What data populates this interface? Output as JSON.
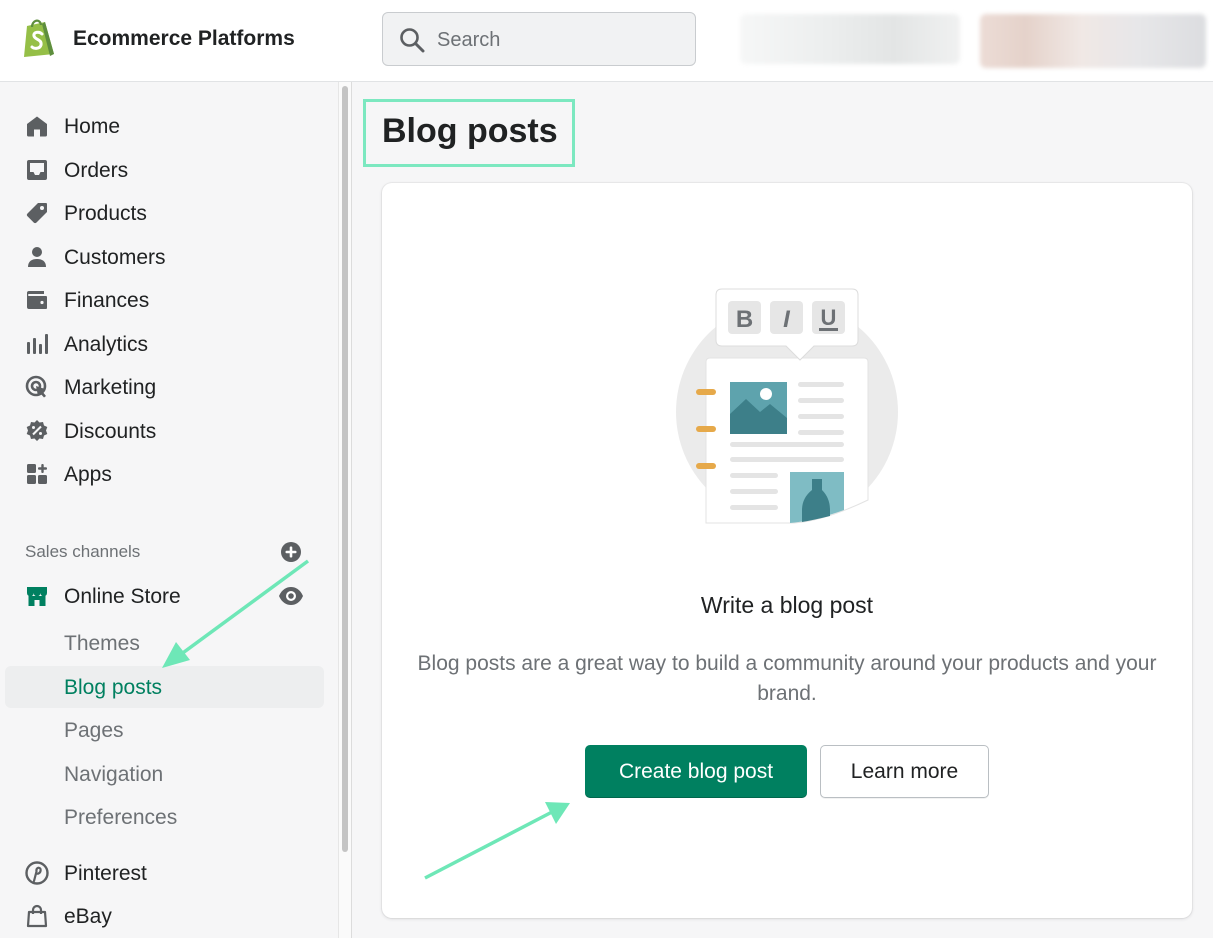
{
  "header": {
    "store_name": "Ecommerce Platforms",
    "search_placeholder": "Search"
  },
  "sidebar": {
    "items": [
      {
        "label": "Home",
        "icon": "home-icon"
      },
      {
        "label": "Orders",
        "icon": "inbox-icon"
      },
      {
        "label": "Products",
        "icon": "tag-icon"
      },
      {
        "label": "Customers",
        "icon": "person-icon"
      },
      {
        "label": "Finances",
        "icon": "wallet-icon"
      },
      {
        "label": "Analytics",
        "icon": "bar-chart-icon"
      },
      {
        "label": "Marketing",
        "icon": "target-icon"
      },
      {
        "label": "Discounts",
        "icon": "discount-icon"
      },
      {
        "label": "Apps",
        "icon": "apps-icon"
      }
    ],
    "sales_channels_label": "Sales channels",
    "online_store": {
      "label": "Online Store",
      "sub_items": [
        "Themes",
        "Blog posts",
        "Pages",
        "Navigation",
        "Preferences"
      ],
      "active": "Blog posts"
    },
    "channels": [
      {
        "label": "Pinterest",
        "icon": "pinterest-icon"
      },
      {
        "label": "eBay",
        "icon": "shopping-bag-icon"
      }
    ]
  },
  "main": {
    "page_title": "Blog posts",
    "empty_state": {
      "heading": "Write a blog post",
      "description": "Blog posts are a great way to build a community around your products and your brand.",
      "primary_action": "Create blog post",
      "secondary_action": "Learn more"
    },
    "illustration_toolbar": [
      "B",
      "I",
      "U"
    ]
  },
  "colors": {
    "accent": "#008060",
    "highlight": "#7ce8c0",
    "sidebar_bg": "#f6f6f7"
  }
}
